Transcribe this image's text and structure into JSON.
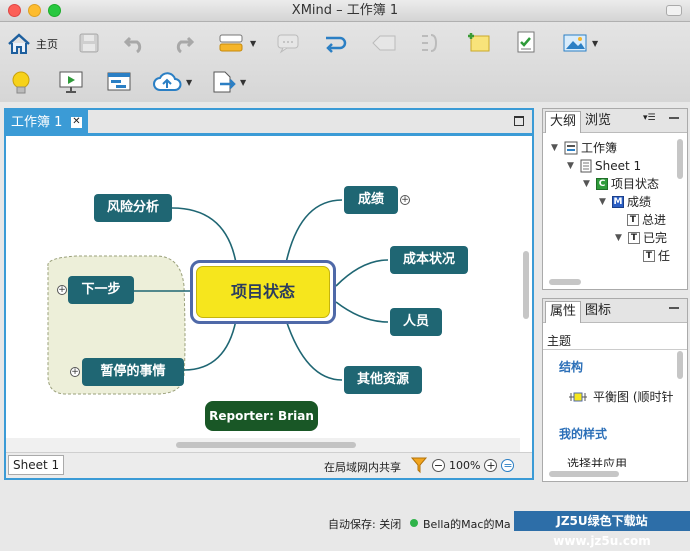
{
  "window": {
    "title": "XMind – 工作簿 1"
  },
  "toolbar": {
    "home_label": "主页"
  },
  "editor": {
    "tab_label": "工作簿 1",
    "sheet_tab": "Sheet 1",
    "share_text": "在局域网内共享",
    "zoom": "100%"
  },
  "map": {
    "central": "项目状态",
    "topics": {
      "risk": "风险分析",
      "next": "下一步",
      "paused": "暂停的事情",
      "results": "成绩",
      "cost": "成本状况",
      "staff": "人员",
      "resources": "其他资源"
    },
    "reporter": "Reporter: Brian"
  },
  "outline": {
    "tabs": [
      "大纲",
      "浏览"
    ],
    "rows": [
      {
        "label": "工作簿",
        "icon": "workbook-icon"
      },
      {
        "label": "Sheet 1",
        "icon": "sheet-icon"
      },
      {
        "label": "项目状态",
        "icon": "central-topic-icon",
        "badge": "C"
      },
      {
        "label": "成绩",
        "icon": "main-topic-icon",
        "badge": "M"
      },
      {
        "label": "总进",
        "icon": "topic-icon",
        "badge": "T"
      },
      {
        "label": "已完",
        "icon": "topic-icon",
        "badge": "T"
      },
      {
        "label": "任",
        "icon": "topic-icon",
        "badge": "T"
      }
    ]
  },
  "properties": {
    "tabs": [
      "属性",
      "图标"
    ],
    "section": "主题",
    "structure_label": "结构",
    "structure_value": "平衡图 (顺时针",
    "style_label": "我的样式",
    "style_value": "选择并应用"
  },
  "statusbar": {
    "autosave": "自动保存: 关闭",
    "user": "Bella的Mac的Ma",
    "watermark": "JZ5U绿色下载站 www.jz5u.com"
  },
  "colors": {
    "accent": "#3b9bd6",
    "topic": "#1f6673",
    "central_fill": "#f6e61d",
    "central_border": "#4f69a8",
    "reporter": "#195726"
  }
}
